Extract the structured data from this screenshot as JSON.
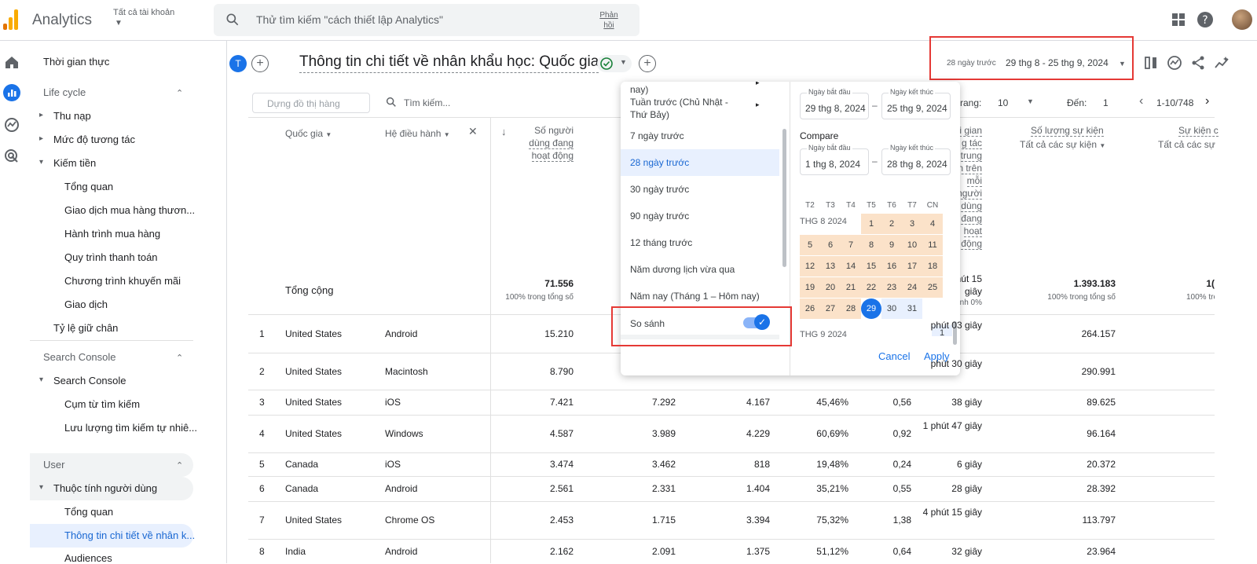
{
  "app": {
    "name": "Analytics",
    "account": "Tất cả tài khoản"
  },
  "search": {
    "placeholder": "Thử tìm kiếm \"cách thiết lập Analytics\"",
    "feedback": "Phản hồi"
  },
  "sidebar": {
    "realtime": "Thời gian thực",
    "lifecycle": "Life cycle",
    "items": [
      "Thu nạp",
      "Mức độ tương tác",
      "Kiếm tiền",
      "Tổng quan",
      "Giao dịch mua hàng thươn...",
      "Hành trình mua hàng",
      "Quy trình thanh toán",
      "Chương trình khuyến mãi",
      "Giao dịch",
      "Tỷ lệ giữ chân"
    ],
    "search_console_section": "Search Console",
    "search_console": "Search Console",
    "sc_items": [
      "Cụm từ tìm kiếm",
      "Lưu lượng tìm kiếm tự nhiê..."
    ],
    "user_section": "User",
    "user_attr": "Thuộc tính người dùng",
    "user_items": [
      "Tổng quan",
      "Thông tin chi tiết về nhân k...",
      "Audiences"
    ]
  },
  "header": {
    "badge": "T",
    "title": "Thông tin chi tiết về nhân khẩu học: Quốc gia",
    "date_label": "28 ngày trước",
    "date_range": "29 thg 8 - 25 thg 9, 2024"
  },
  "toolbar": {
    "filter_placeholder": "Dựng đồ thị hàng",
    "search_placeholder": "Tìm kiếm...",
    "rows_label": "rang:",
    "rows_value": "10",
    "goto_label": "Đến:",
    "goto_value": "1",
    "range": "1-10/748"
  },
  "table": {
    "headers": {
      "country": "Quốc gia",
      "os": "Hệ điều hành",
      "users_line1": "Số người",
      "users_line2": "dùng đang",
      "users_line3": "hoạt động",
      "time_lines": [
        "i gian",
        "g tác",
        "trung",
        "n trên",
        "mỗi",
        "người",
        "dùng",
        "đang",
        "hoạt",
        "động"
      ],
      "events": "Số lượng sự kiện",
      "events_sub": "Tất cả các sự kiện",
      "events2": "Sự kiện c",
      "events2_sub": "Tất cả các sự"
    },
    "total_label": "Tổng cộng",
    "totals": {
      "users": "71.556",
      "users_sub": "100% trong tổng số",
      "time": "phút 15 giây",
      "time_sub": "nh 0%",
      "events": "1.393.183",
      "events_sub": "100% trong tổng số",
      "events2": "1(",
      "events2_sub": "100% tro"
    },
    "rows": [
      {
        "n": "1",
        "country": "United States",
        "os": "Android",
        "users": "15.210",
        "c2": "",
        "c3": "",
        "c4": "",
        "c5": "",
        "time": "phút 03 giây",
        "events": "264.157"
      },
      {
        "n": "2",
        "country": "United States",
        "os": "Macintosh",
        "users": "8.790",
        "c2": "",
        "c3": "",
        "c4": "",
        "c5": "",
        "time": "phút 30 giây",
        "events": "290.991"
      },
      {
        "n": "3",
        "country": "United States",
        "os": "iOS",
        "users": "7.421",
        "c2": "7.292",
        "c3": "4.167",
        "c4": "45,46%",
        "c5": "0,56",
        "time": "38 giây",
        "events": "89.625"
      },
      {
        "n": "4",
        "country": "United States",
        "os": "Windows",
        "users": "4.587",
        "c2": "3.989",
        "c3": "4.229",
        "c4": "60,69%",
        "c5": "0,92",
        "time": "1 phút 47 giây",
        "events": "96.164"
      },
      {
        "n": "5",
        "country": "Canada",
        "os": "iOS",
        "users": "3.474",
        "c2": "3.462",
        "c3": "818",
        "c4": "19,48%",
        "c5": "0,24",
        "time": "6 giây",
        "events": "20.372"
      },
      {
        "n": "6",
        "country": "Canada",
        "os": "Android",
        "users": "2.561",
        "c2": "2.331",
        "c3": "1.404",
        "c4": "35,21%",
        "c5": "0,55",
        "time": "28 giây",
        "events": "28.392"
      },
      {
        "n": "7",
        "country": "United States",
        "os": "Chrome OS",
        "users": "2.453",
        "c2": "1.715",
        "c3": "3.394",
        "c4": "75,32%",
        "c5": "1,38",
        "time": "4 phút 15 giây",
        "events": "113.797"
      },
      {
        "n": "8",
        "country": "India",
        "os": "Android",
        "users": "2.162",
        "c2": "2.091",
        "c3": "1.375",
        "c4": "51,12%",
        "c5": "0,64",
        "time": "32 giây",
        "events": "23.964"
      }
    ]
  },
  "dropdown": {
    "partial_top": "nay)",
    "items": [
      "Tuần trước (Chủ Nhật - Thứ Bảy)",
      "7 ngày trước",
      "28 ngày trước",
      "30 ngày trước",
      "90 ngày trước",
      "12 tháng trước",
      "Năm dương lịch vừa qua",
      "Năm nay (Tháng 1 – Hôm nay)"
    ],
    "selected": "28 ngày trước",
    "compare_label": "So sánh",
    "compare_on": true,
    "start_label": "Ngày bắt đầu",
    "end_label": "Ngày kết thúc",
    "primary_start": "29 thg 8, 2024",
    "primary_end": "25 thg 9, 2024",
    "compare_title": "Compare",
    "compare_start": "1 thg 8, 2024",
    "compare_end": "28 thg 8, 2024",
    "weekdays": [
      "T2",
      "T3",
      "T4",
      "T5",
      "T6",
      "T7",
      "CN"
    ],
    "month1": "THG 8 2024",
    "month2": "THG 9 2024",
    "next_day": "1",
    "cancel": "Cancel",
    "apply": "Apply"
  },
  "colors": {
    "accent": "#1a73e8",
    "highlight": "#e53935",
    "compare_range": "#fbe2c9"
  }
}
